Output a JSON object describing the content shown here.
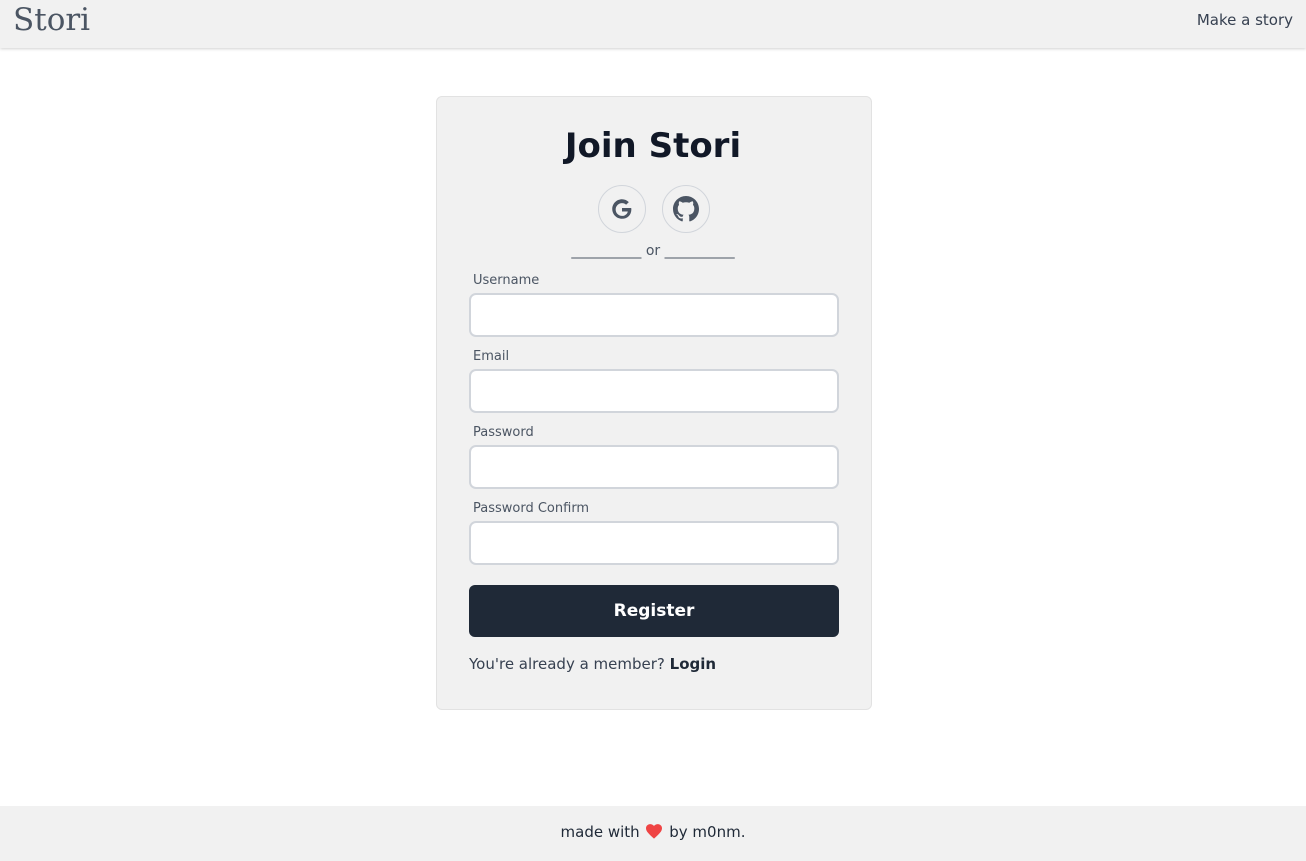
{
  "navbar": {
    "brand": "Stori",
    "make_story_link": "Make a story"
  },
  "card": {
    "title": "Join Stori",
    "oauth": [
      {
        "icon": "google-icon"
      },
      {
        "icon": "github-icon"
      }
    ],
    "divider_text": "__________ or __________",
    "fields": {
      "username_label": "Username",
      "email_label": "Email",
      "password_label": "Password",
      "password_confirm_label": "Password Confirm"
    },
    "register_label": "Register",
    "member_prompt": "You're already a member?",
    "login_link": "Login"
  },
  "footer": {
    "prefix": "made with",
    "suffix": "by m0nm.",
    "heart_icon": "heart-icon"
  },
  "colors": {
    "navbar_bg": "#f1f1f1",
    "card_bg": "#f1f1f1",
    "button_bg": "#1f2937",
    "heart": "#ef4444"
  }
}
